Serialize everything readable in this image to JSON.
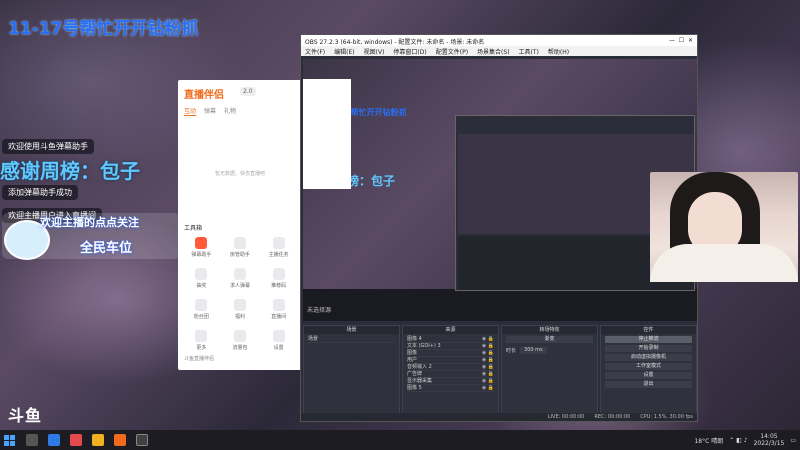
{
  "stream": {
    "overlay_title": "11-17号帮忙开开钻粉抓",
    "chat_lines": [
      "欢迎使用斗鱼弹幕助手",
      "添加弹幕助手成功",
      "欢迎主播用户进入直播间"
    ],
    "thanks": "感谢周榜：包子",
    "welcome_line1": "欢迎主播的点点关注",
    "welcome_line2": "全民车位",
    "logo": "斗鱼"
  },
  "assistant": {
    "logo": "直播伴侣",
    "badge": "2.0",
    "tabs": [
      "互动",
      "弹幕",
      "礼物"
    ],
    "empty_hint": "暂无数据，快去直播吧",
    "tool_title": "工具箱",
    "tools": [
      {
        "label": "弹幕助手",
        "hot": true
      },
      {
        "label": "房管助手",
        "hot": false
      },
      {
        "label": "主播任务",
        "hot": false
      },
      {
        "label": "抽奖",
        "hot": false
      },
      {
        "label": "求人弹幕",
        "hot": false
      },
      {
        "label": "推荐码",
        "hot": false
      },
      {
        "label": "粉丝团",
        "hot": false
      },
      {
        "label": "福利",
        "hot": false
      },
      {
        "label": "直播间",
        "hot": false
      },
      {
        "label": "更多",
        "hot": false
      },
      {
        "label": "流量包",
        "hot": false
      },
      {
        "label": "设置",
        "hot": false
      }
    ],
    "footer": "斗鱼直播伴侣"
  },
  "obs": {
    "title": "OBS 27.2.3 (64-bit, windows) - 配置文件: 未命名 - 场景: 未命名",
    "menu": [
      "文件(F)",
      "编辑(E)",
      "视图(V)",
      "停靠窗口(D)",
      "配置文件(P)",
      "场景集合(S)",
      "工具(T)",
      "帮助(H)"
    ],
    "unnamed_scene": "未选择源",
    "docks": {
      "scenes": {
        "title": "场景",
        "items": [
          "场景"
        ]
      },
      "sources": {
        "title": "来源",
        "items": [
          "图像 4",
          "文本 (GDI+) 3",
          "图像",
          "用户",
          "音频输入 2",
          "广告牌",
          "显示器采集",
          "图像 5"
        ]
      },
      "mixer": {
        "title": "转场特效",
        "fade": "渐变",
        "duration_label": "时长",
        "duration": "300 ms"
      },
      "controls": {
        "title": "控件",
        "buttons": [
          "停止推流",
          "开始录制",
          "启动虚拟摄像机",
          "工作室模式",
          "设置",
          "退出"
        ]
      }
    },
    "status": [
      "LIVE: 00:00:00",
      "REC: 00:00:00",
      "CPU: 1.5%, 30.00 fps"
    ]
  },
  "taskbar": {
    "weather": "18°C 晴朗",
    "time": "14:05",
    "date": "2022/3/15"
  }
}
